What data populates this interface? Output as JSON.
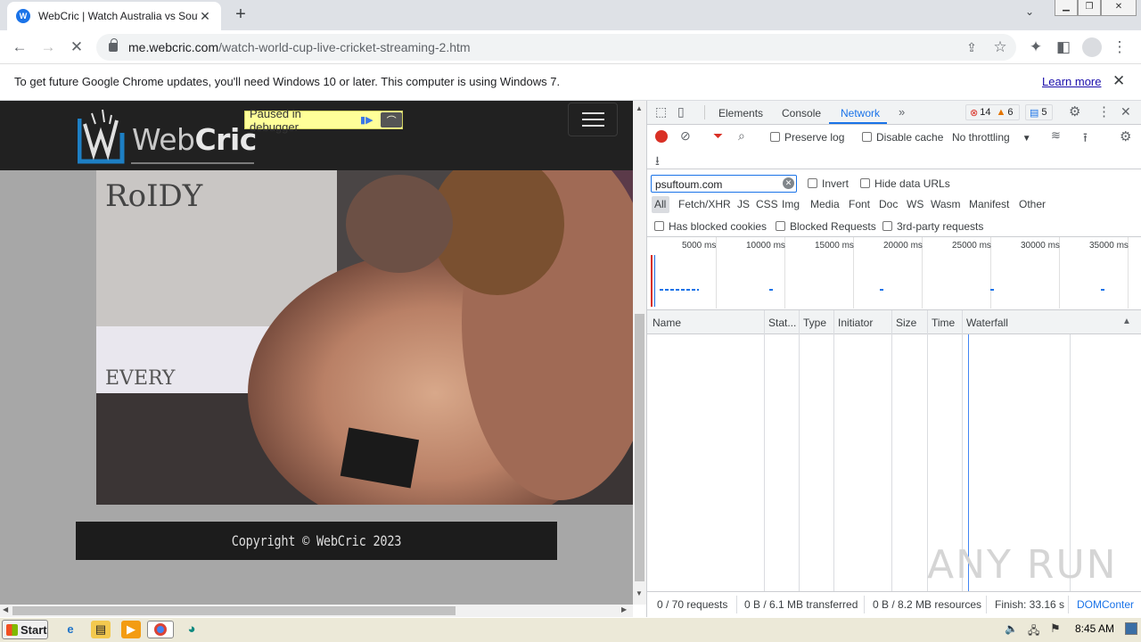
{
  "browser": {
    "tab_title": "WebCric | Watch Australia vs South",
    "url_host": "me.webcric.com",
    "url_path": "/watch-world-cup-live-cricket-streaming-2.htm"
  },
  "infobar": {
    "message": "To get future Google Chrome updates, you'll need Windows 10 or later. This computer is using Windows 7.",
    "link": "Learn more"
  },
  "page": {
    "logo_web": "Web",
    "logo_cric": "Cric",
    "debugger_text": "Paused in debugger",
    "copyright": "Copyright © WebCric 2023"
  },
  "devtools": {
    "tabs": [
      "Elements",
      "Console",
      "Network"
    ],
    "active_tab": "Network",
    "badges": {
      "errors": "14",
      "warnings": "6",
      "messages": "5"
    },
    "toolbar": {
      "preserve_log": "Preserve log",
      "disable_cache": "Disable cache",
      "throttling": "No throttling"
    },
    "filter": {
      "value": "psuftoum.com",
      "invert": "Invert",
      "hide_data_urls": "Hide data URLs"
    },
    "types": [
      "All",
      "Fetch/XHR",
      "JS",
      "CSS",
      "Img",
      "Media",
      "Font",
      "Doc",
      "WS",
      "Wasm",
      "Manifest",
      "Other"
    ],
    "checks": {
      "blocked_cookies": "Has blocked cookies",
      "blocked_requests": "Blocked Requests",
      "third_party": "3rd-party requests"
    },
    "timeline_ticks": [
      "5000 ms",
      "10000 ms",
      "15000 ms",
      "20000 ms",
      "25000 ms",
      "30000 ms",
      "35000 ms"
    ],
    "columns": [
      "Name",
      "Stat...",
      "Type",
      "Initiator",
      "Size",
      "Time",
      "Waterfall"
    ],
    "status": {
      "requests": "0 / 70 requests",
      "transferred": "0 B / 6.1 MB transferred",
      "resources": "0 B / 8.2 MB resources",
      "finish": "Finish: 33.16 s",
      "dom": "DOMConter"
    }
  },
  "watermark": "ANY RUN",
  "taskbar": {
    "start": "Start",
    "time": "8:45 AM"
  }
}
